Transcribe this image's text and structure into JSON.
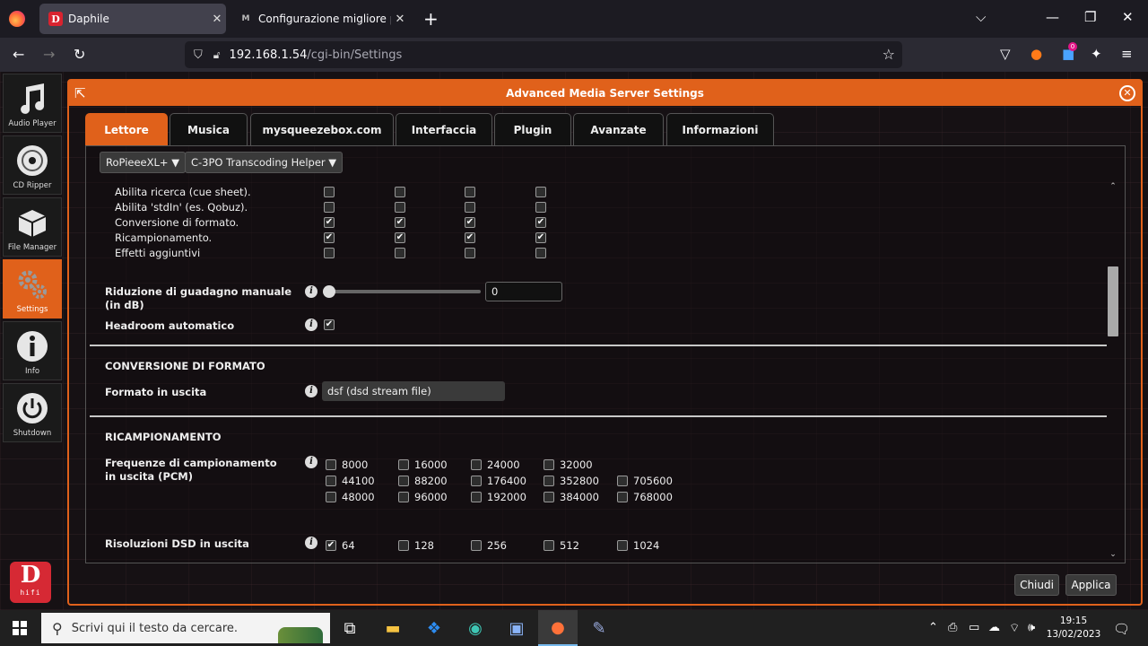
{
  "browser": {
    "tabs": [
      {
        "title": "Daphile",
        "favicon": "D"
      },
      {
        "title": "Configurazione migliore per Da",
        "favicon": "M"
      }
    ],
    "url_host": "192.168.1.54",
    "url_path": "/cgi-bin/Settings",
    "extension_badge": "0"
  },
  "sidebar": {
    "items": [
      {
        "label": "Audio Player",
        "icon": "music-note-icon"
      },
      {
        "label": "CD Ripper",
        "icon": "cd-icon"
      },
      {
        "label": "File Manager",
        "icon": "box-icon"
      },
      {
        "label": "Settings",
        "icon": "gears-icon"
      },
      {
        "label": "Info",
        "icon": "info-icon"
      },
      {
        "label": "Shutdown",
        "icon": "power-icon"
      }
    ],
    "logo_big": "D",
    "logo_small": "hifi"
  },
  "dialog": {
    "title": "Advanced Media Server Settings",
    "tabs": [
      "Lettore",
      "Musica",
      "mysqueezebox.com",
      "Interfaccia",
      "Plugin",
      "Avanzate",
      "Informazioni"
    ],
    "player_select": "RoPieeeXL+",
    "plugin_select": "C-3PO Transcoding Helper",
    "feature_rows": [
      {
        "label": "Abilita ricerca (cue sheet).",
        "checks": [
          false,
          false,
          false,
          false
        ]
      },
      {
        "label": "Abilita 'stdIn' (es. Qobuz).",
        "checks": [
          false,
          false,
          false,
          false
        ]
      },
      {
        "label": "Conversione di formato.",
        "checks": [
          true,
          true,
          true,
          true
        ]
      },
      {
        "label": "Ricampionamento.",
        "checks": [
          true,
          true,
          true,
          true
        ]
      },
      {
        "label": "Effetti aggiuntivi",
        "checks": [
          false,
          false,
          false,
          false
        ]
      }
    ],
    "gain_label": "Riduzione di guadagno manuale (in dB)",
    "gain_value": "0",
    "gain_level": 0,
    "headroom_label": "Headroom automatico",
    "headroom_checked": true,
    "section_format": "CONVERSIONE DI FORMATO",
    "output_format_label": "Formato in uscita",
    "output_format_value": "dsf (dsd stream file)",
    "section_resample": "RICAMPIONAMENTO",
    "rates_label": "Frequenze di campionamento in uscita (PCM)",
    "rates": [
      [
        {
          "v": "8000",
          "c": false
        },
        {
          "v": "16000",
          "c": false
        },
        {
          "v": "24000",
          "c": false
        },
        {
          "v": "32000",
          "c": false
        }
      ],
      [
        {
          "v": "44100",
          "c": false
        },
        {
          "v": "88200",
          "c": false
        },
        {
          "v": "176400",
          "c": false
        },
        {
          "v": "352800",
          "c": false
        },
        {
          "v": "705600",
          "c": false
        }
      ],
      [
        {
          "v": "48000",
          "c": false
        },
        {
          "v": "96000",
          "c": false
        },
        {
          "v": "192000",
          "c": false
        },
        {
          "v": "384000",
          "c": false
        },
        {
          "v": "768000",
          "c": false
        }
      ]
    ],
    "dsd_label": "Risoluzioni DSD in uscita",
    "dsd": [
      {
        "v": "64",
        "c": true
      },
      {
        "v": "128",
        "c": false
      },
      {
        "v": "256",
        "c": false
      },
      {
        "v": "512",
        "c": false
      },
      {
        "v": "1024",
        "c": false
      }
    ],
    "close_label": "Chiudi",
    "apply_label": "Applica"
  },
  "taskbar": {
    "search_placeholder": "Scrivi qui il testo da cercare.",
    "time": "19:15",
    "date": "13/02/2023"
  }
}
